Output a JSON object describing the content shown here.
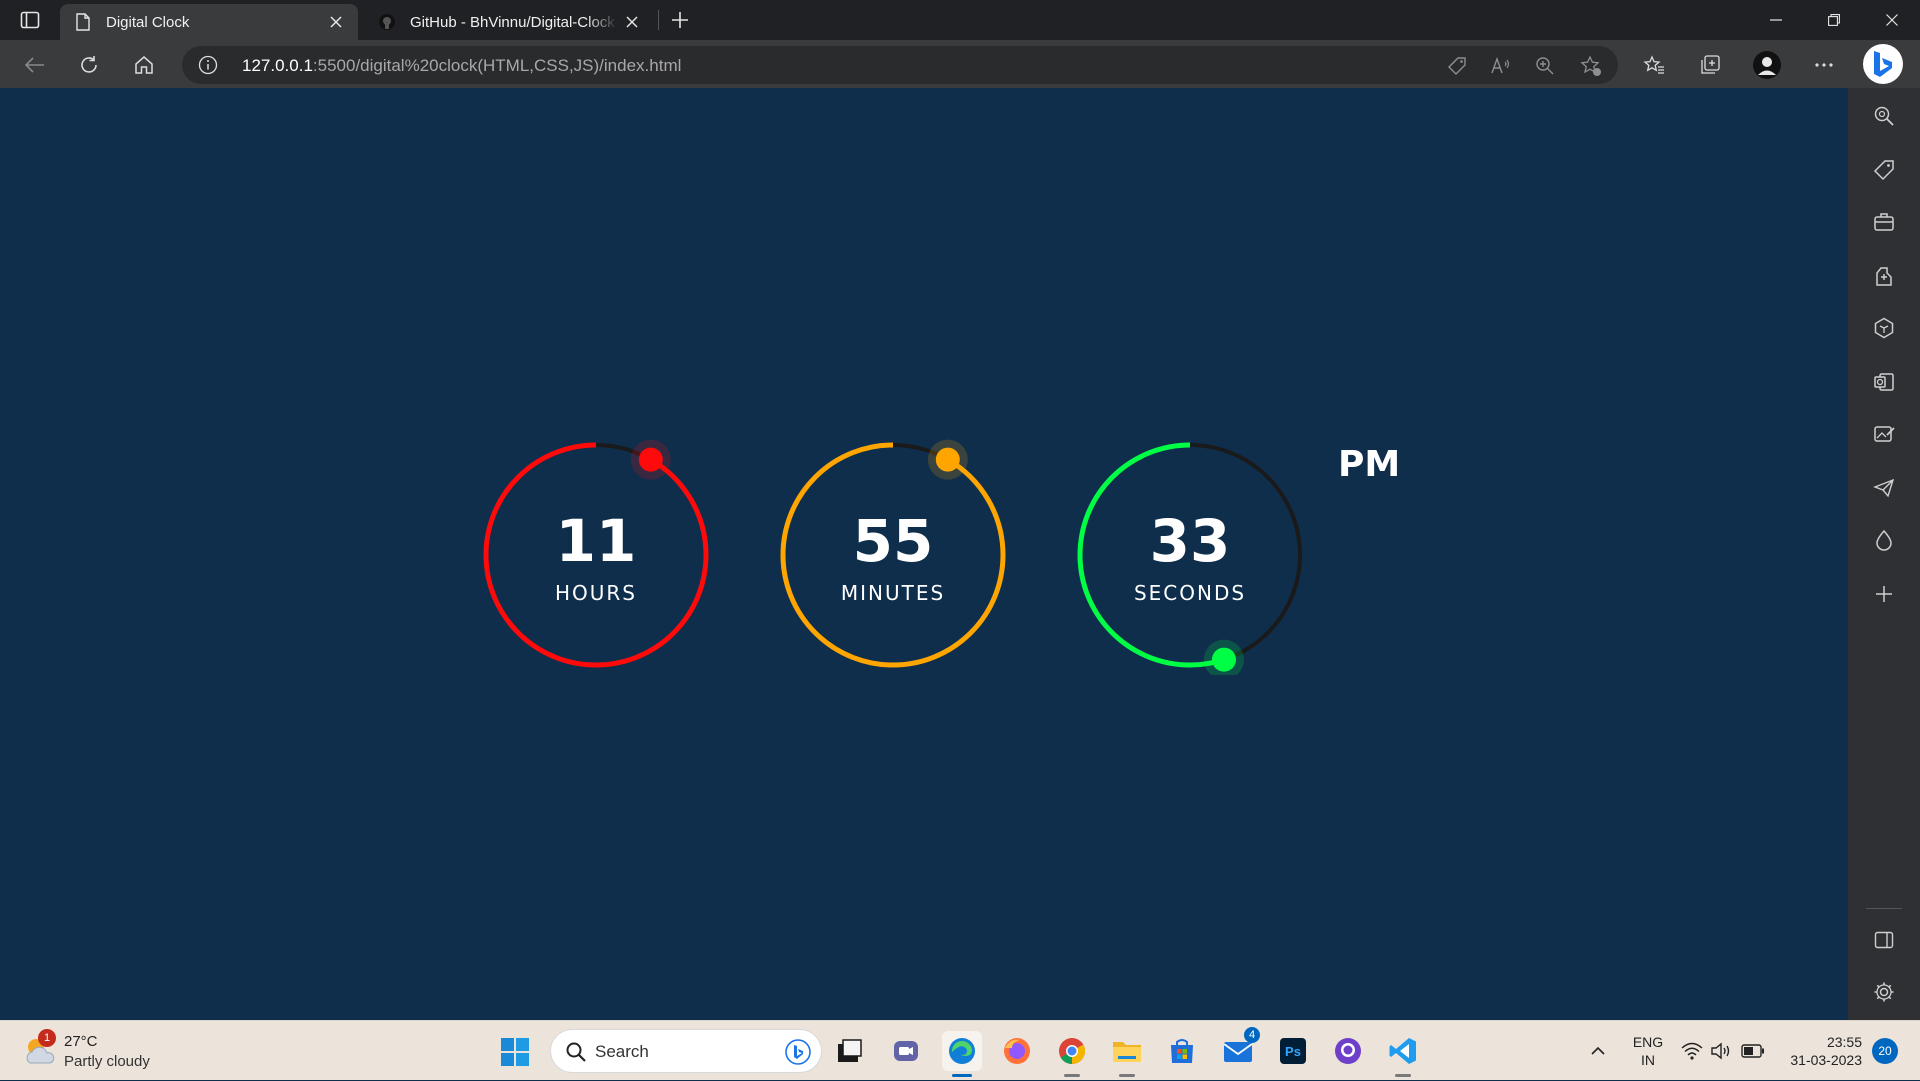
{
  "browser": {
    "tabs": [
      {
        "title": "Digital Clock",
        "favicon": "page-icon",
        "active": true
      },
      {
        "title": "GitHub - BhVinnu/Digital-Clock-HTML-CSS-JS",
        "favicon": "github-icon",
        "active": false
      }
    ],
    "address": {
      "host": "127.0.0.1",
      "path": ":5500/digital%20clock(HTML,CSS,JS)/index.html"
    }
  },
  "clock": {
    "hours": {
      "value": "11",
      "label": "HOURS",
      "color": "#ff0a0a",
      "progress": 0.917
    },
    "minutes": {
      "value": "55",
      "label": "MINUTES",
      "color": "#ffa500",
      "progress": 0.917
    },
    "seconds": {
      "value": "33",
      "label": "SECONDS",
      "color": "#00ff44",
      "progress": 0.55
    },
    "ampm": "PM"
  },
  "taskbar": {
    "weather": {
      "temp": "27°C",
      "condition": "Partly cloudy",
      "badge": "1"
    },
    "search_label": "Search",
    "mail_badge": "4",
    "lang_line1": "ENG",
    "lang_line2": "IN",
    "time": "23:55",
    "date": "31-03-2023",
    "notifications": "20"
  },
  "colors": {
    "page_background": "#0f2e4c",
    "track": "#1a1a1a"
  }
}
